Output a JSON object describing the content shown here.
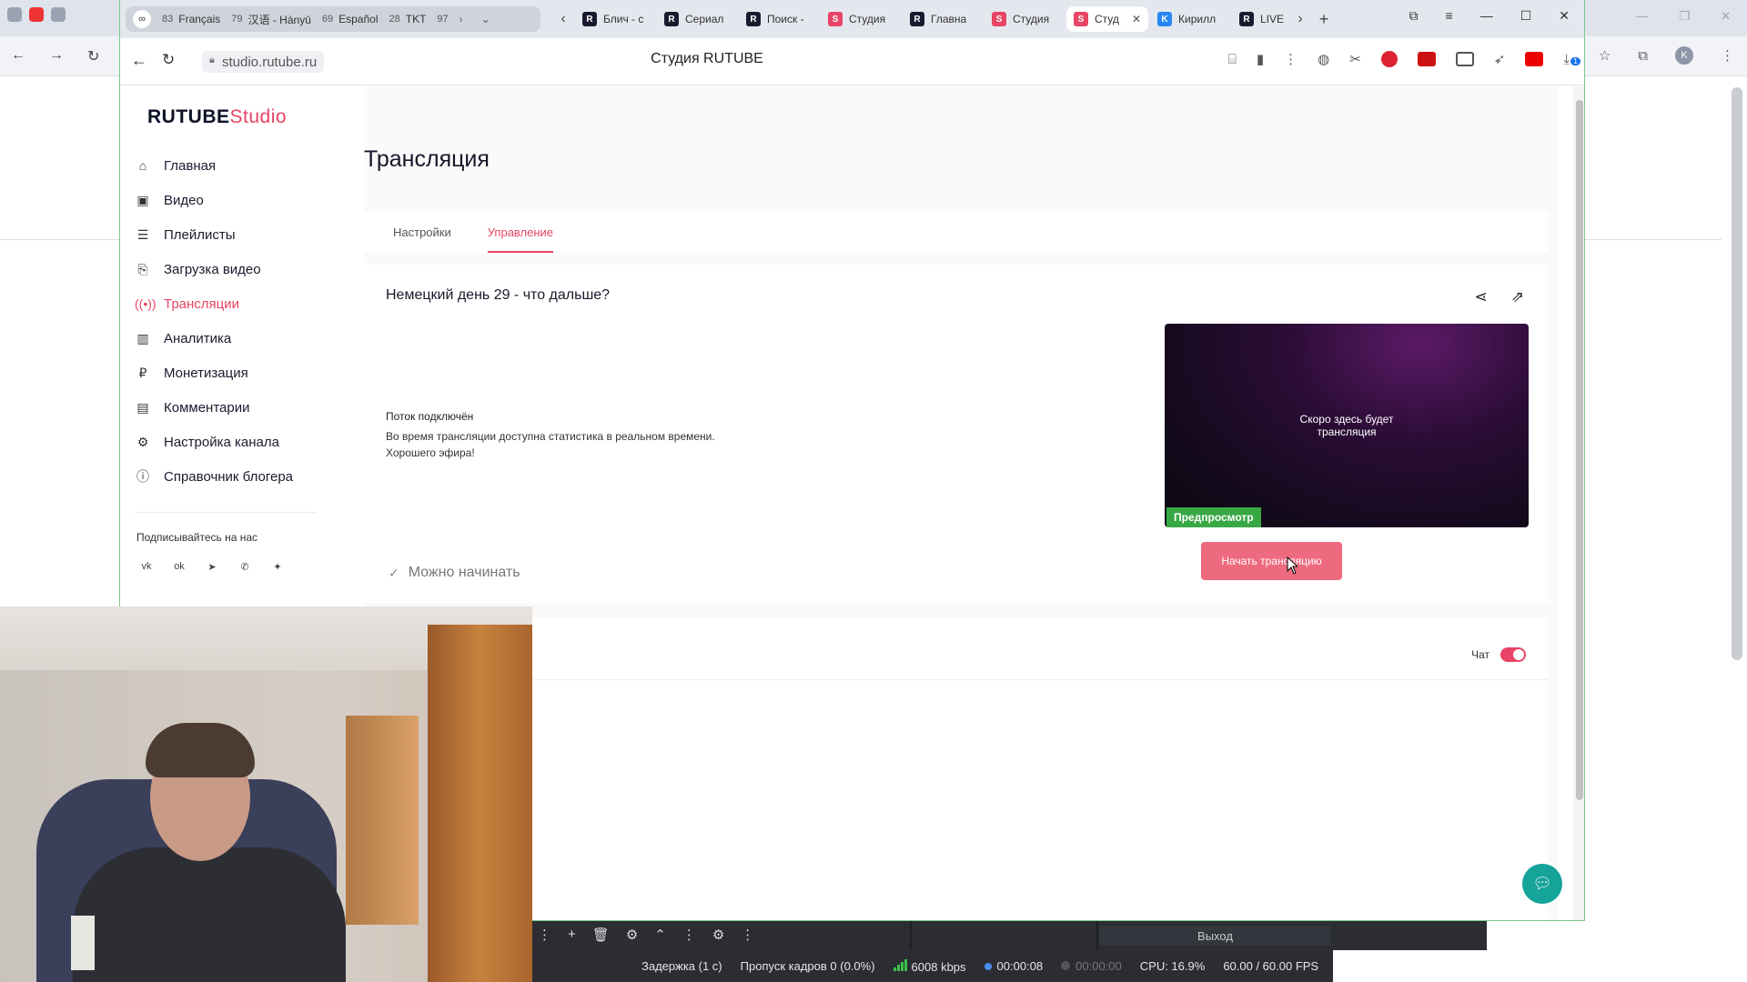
{
  "browser": {
    "tab_groups": [
      {
        "count": "83",
        "label": "Français"
      },
      {
        "count": "79",
        "label": "汉语 - Hànyǔ"
      },
      {
        "count": "69",
        "label": "Español"
      },
      {
        "count": "28",
        "label": "TKT"
      },
      {
        "count": "97",
        "label": ""
      }
    ],
    "infinity_label": "∞",
    "tabs": [
      {
        "label": "Блич - с",
        "favicon": "R"
      },
      {
        "label": "Сериал",
        "favicon": "R"
      },
      {
        "label": "Поиск -",
        "favicon": "R"
      },
      {
        "label": "Студия",
        "favicon": "S"
      },
      {
        "label": "Главна",
        "favicon": "R"
      },
      {
        "label": "Студия",
        "favicon": "S"
      },
      {
        "label": "Студ",
        "favicon": "S",
        "active": true
      },
      {
        "label": "Кирилл",
        "favicon": "VK"
      },
      {
        "label": "LIVE",
        "favicon": "R"
      }
    ],
    "url": "studio.rutube.ru",
    "page_title": "Студия RUTUBE",
    "download_badge": "1"
  },
  "outer_browser": {
    "profile_initial": "K"
  },
  "logo": {
    "brand": "RUTUBE",
    "product": "Studio"
  },
  "sidebar": {
    "items": [
      {
        "label": "Главная",
        "icon": "home-icon"
      },
      {
        "label": "Видео",
        "icon": "video-icon"
      },
      {
        "label": "Плейлисты",
        "icon": "playlist-icon"
      },
      {
        "label": "Загрузка видео",
        "icon": "upload-icon"
      },
      {
        "label": "Трансляции",
        "icon": "broadcast-icon",
        "active": true
      },
      {
        "label": "Аналитика",
        "icon": "analytics-icon"
      },
      {
        "label": "Монетизация",
        "icon": "ruble-icon"
      },
      {
        "label": "Комментарии",
        "icon": "comment-icon"
      },
      {
        "label": "Настройка канала",
        "icon": "gear-icon"
      },
      {
        "label": "Справочник блогера",
        "icon": "info-icon"
      }
    ],
    "follow_label": "Подписывайтесь на нас",
    "socials": [
      "vk",
      "ok",
      "telegram",
      "viber",
      "more"
    ]
  },
  "main": {
    "title": "Трансляция",
    "tabs": [
      {
        "label": "Настройки"
      },
      {
        "label": "Управление",
        "active": true
      }
    ],
    "stream": {
      "title": "Немецкий день 29 - что дальше?",
      "status_heading": "Поток подключён",
      "status_line1": "Во время трансляции доступна статистика в реальном времени.",
      "status_line2": "Хорошего эфира!",
      "preview_line1": "Скоро здесь будет",
      "preview_line2": "трансляция",
      "preview_badge": "Предпросмотр",
      "ready_label": "Можно начинать",
      "start_button": "Начать трансляцию"
    },
    "chat": {
      "label": "Чат",
      "enabled": true
    }
  },
  "obs": {
    "exit_label": "Выход",
    "delay": "Задержка (1 с)",
    "dropped_frames": "Пропуск кадров 0 (0.0%)",
    "bitrate": "6008 kbps",
    "stream_time": "00:00:08",
    "record_time": "00:00:00",
    "cpu": "CPU: 16.9%",
    "fps": "60.00 / 60.00 FPS"
  },
  "colors": {
    "accent": "#e84465",
    "preview_badge": "#38a844",
    "help_fab": "#16a39a"
  }
}
